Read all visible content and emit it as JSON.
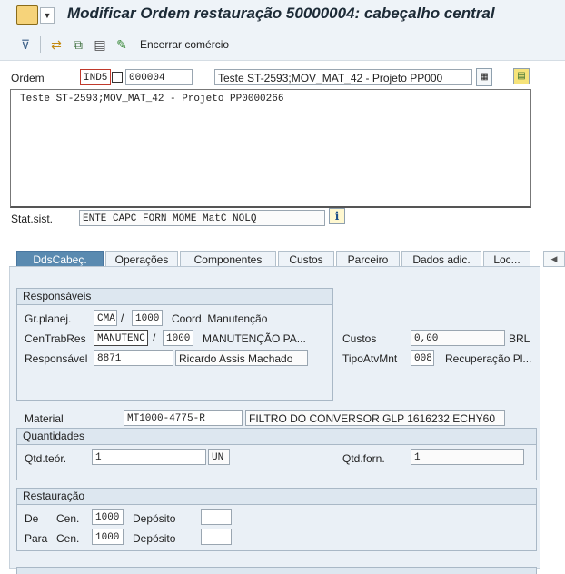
{
  "window": {
    "title": "Modificar Ordem restauração 50000004: cabeçalho central"
  },
  "toolbar": {
    "end_label": "Encerrar comércio",
    "icons": [
      "layout-icon",
      "transfer-icon",
      "copy-icon",
      "document-icon",
      "edit-icon"
    ]
  },
  "header": {
    "order_label": "Ordem",
    "order_type": "IND5",
    "order_number": "000004",
    "order_description": "Teste ST-2593;MOV_MAT_42 - Projeto PP000",
    "long_text": "Teste ST-2593;MOV_MAT_42 - Projeto PP0000266",
    "status_label": "Stat.sist.",
    "status_value": "ENTE CAPC FORN MOME MatC NOLQ"
  },
  "tabs": [
    {
      "label": "DdsCabeç."
    },
    {
      "label": "Operações"
    },
    {
      "label": "Componentes"
    },
    {
      "label": "Custos"
    },
    {
      "label": "Parceiro"
    },
    {
      "label": "Dados adic."
    },
    {
      "label": "Loc..."
    }
  ],
  "responsaveis": {
    "title": "Responsáveis",
    "grplanej_label": "Gr.planej.",
    "grplanej_value": "CMA",
    "grplanej_center": "1000",
    "grplanej_desc": "Coord. Manutenção",
    "centrab_label": "CenTrabRes",
    "centrab_value": "MANUTENC",
    "centrab_center": "1000",
    "centrab_desc": "MANUTENÇÃO PA...",
    "responsavel_label": "Responsável",
    "responsavel_value": "8871",
    "responsavel_name": "Ricardo Assis Machado",
    "custos_label": "Custos",
    "custos_value": "0,00",
    "custos_currency": "BRL",
    "tipoatv_label": "TipoAtvMnt",
    "tipoatv_value": "008",
    "tipoatv_desc": "Recuperação Pl..."
  },
  "material": {
    "label": "Material",
    "value": "MT1000-4775-R",
    "description": "FILTRO DO CONVERSOR GLP 1616232 ECHY60"
  },
  "quantidades": {
    "title": "Quantidades",
    "qtd_teor_label": "Qtd.teór.",
    "qtd_teor_value": "1",
    "unit": "UN",
    "qtd_forn_label": "Qtd.forn.",
    "qtd_forn_value": "1"
  },
  "restauracao": {
    "title": "Restauração",
    "de_label": "De",
    "para_label": "Para",
    "cen_label": "Cen.",
    "deposito_label": "Depósito",
    "de_cen_value": "1000",
    "para_cen_value": "1000",
    "de_deposito_value": "",
    "para_deposito_value": ""
  },
  "colors": {
    "active_tab": "#5a8ab0",
    "panel_bg": "#eaf0f6",
    "titlebar_bg": "#eef3f8"
  }
}
